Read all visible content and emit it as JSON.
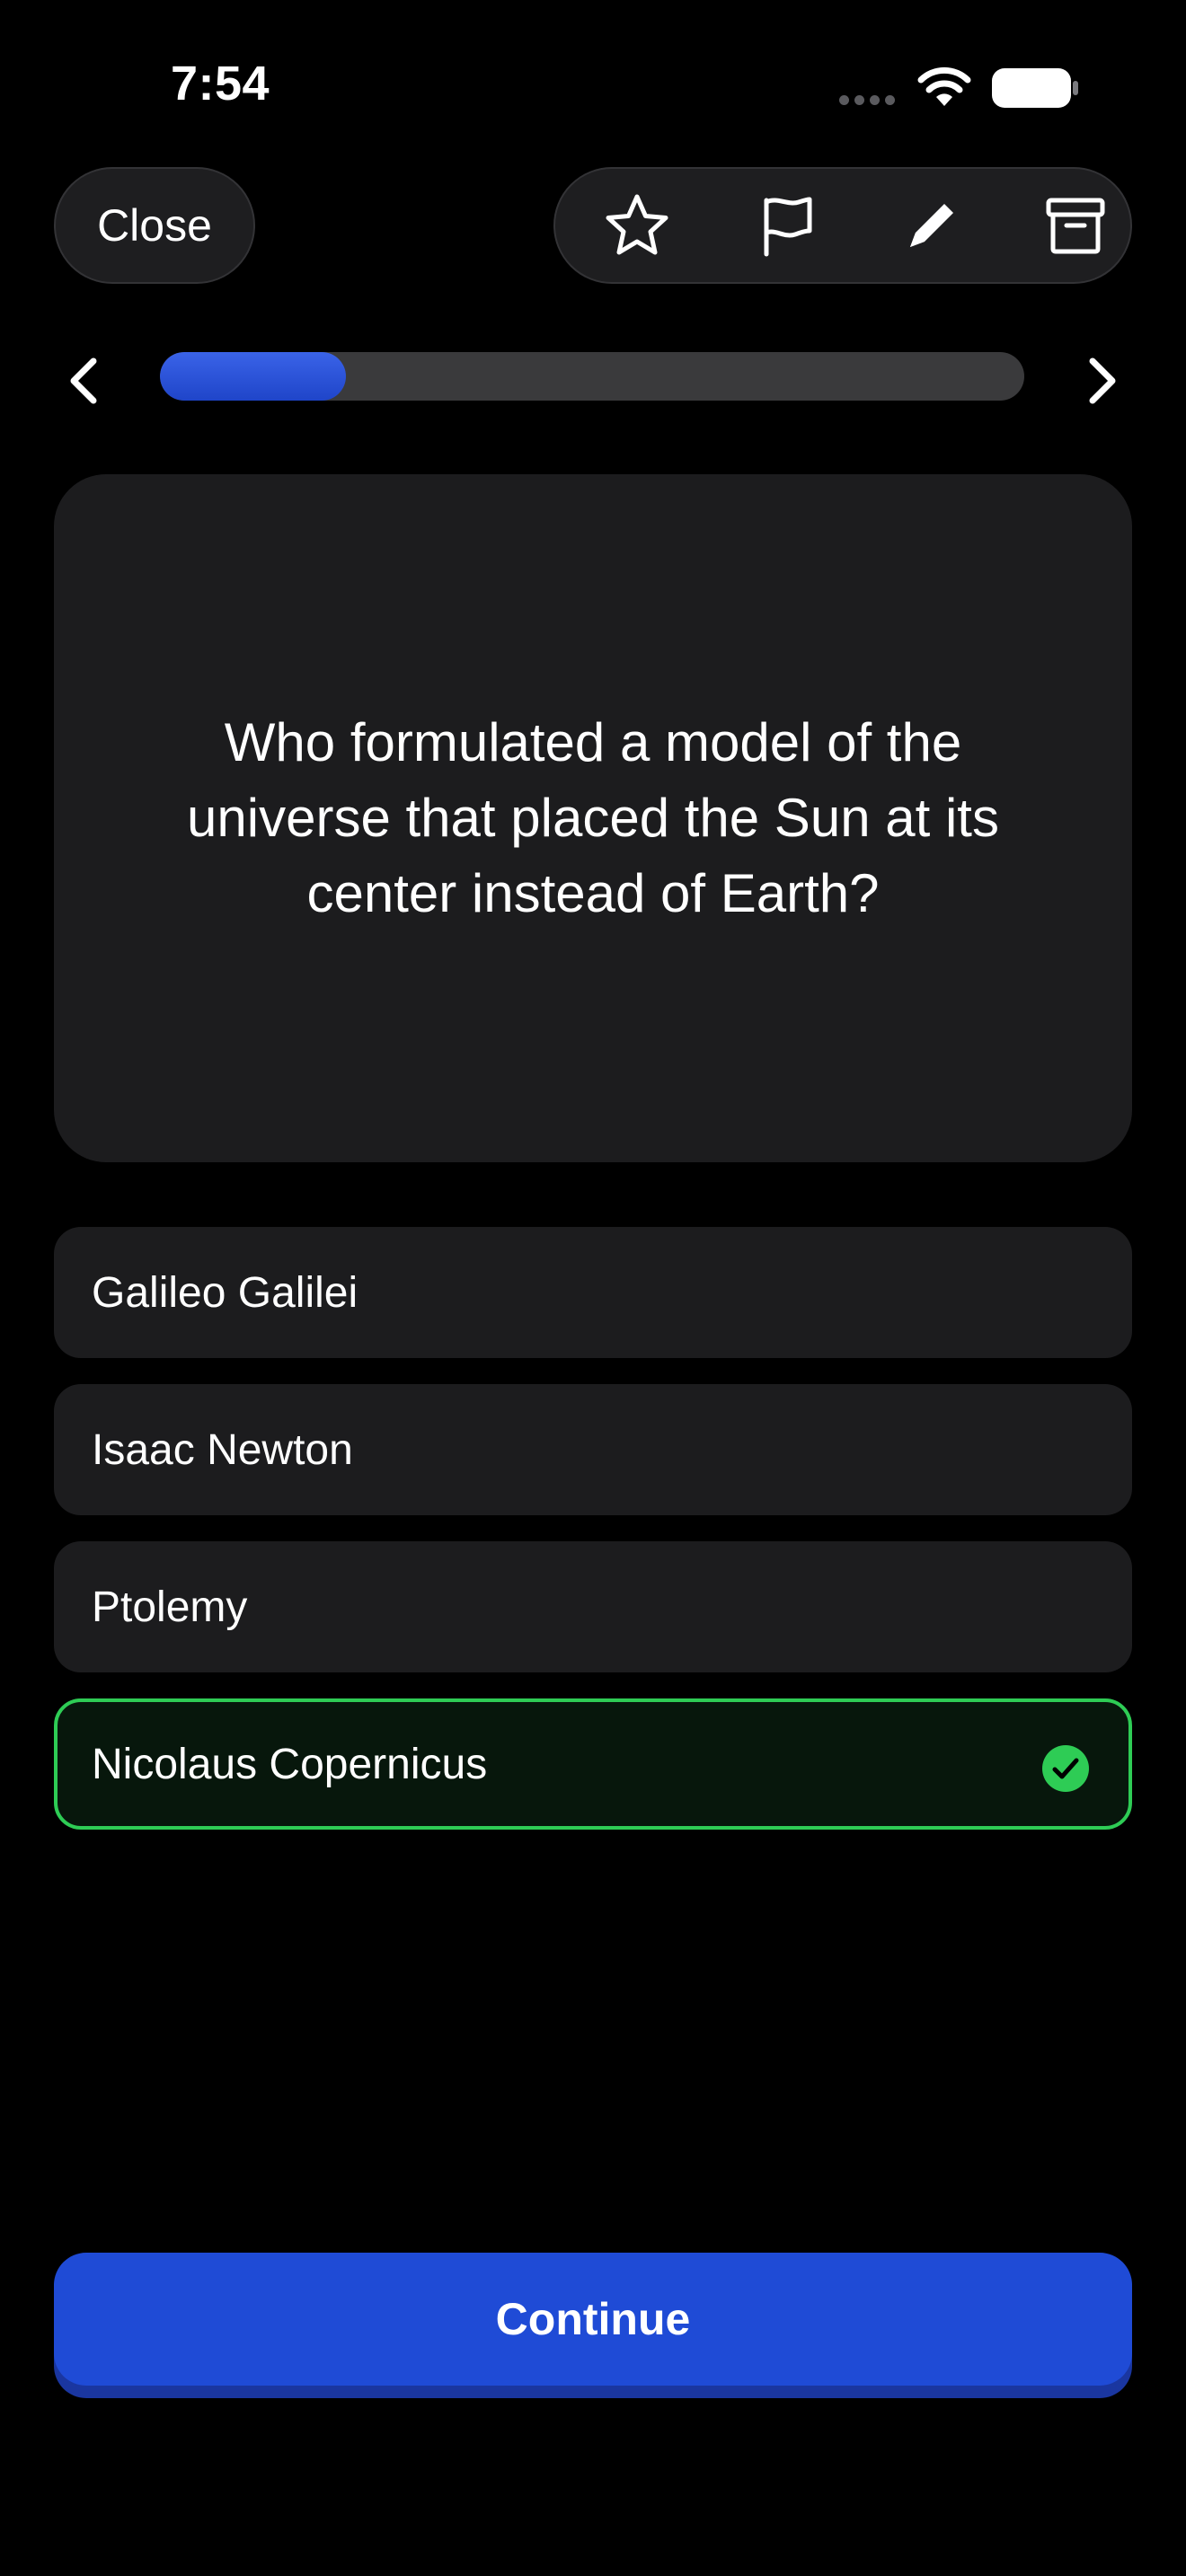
{
  "status_bar": {
    "time": "7:54"
  },
  "toolbar": {
    "close_label": "Close",
    "icons": [
      "star-icon",
      "flag-icon",
      "pencil-icon",
      "archive-icon"
    ]
  },
  "progress": {
    "fraction": 0.215
  },
  "question": {
    "text": "Who formulated a model of the universe that placed the Sun at its center instead of Earth?"
  },
  "answers": [
    {
      "label": "Galileo Galilei",
      "state": "default"
    },
    {
      "label": "Isaac Newton",
      "state": "default"
    },
    {
      "label": "Ptolemy",
      "state": "default"
    },
    {
      "label": "Nicolaus Copernicus",
      "state": "correct"
    }
  ],
  "continue_label": "Continue",
  "colors": {
    "accent": "#1f4bd6",
    "correct": "#2ecc55",
    "card": "#1c1c1e",
    "background": "#000000"
  }
}
